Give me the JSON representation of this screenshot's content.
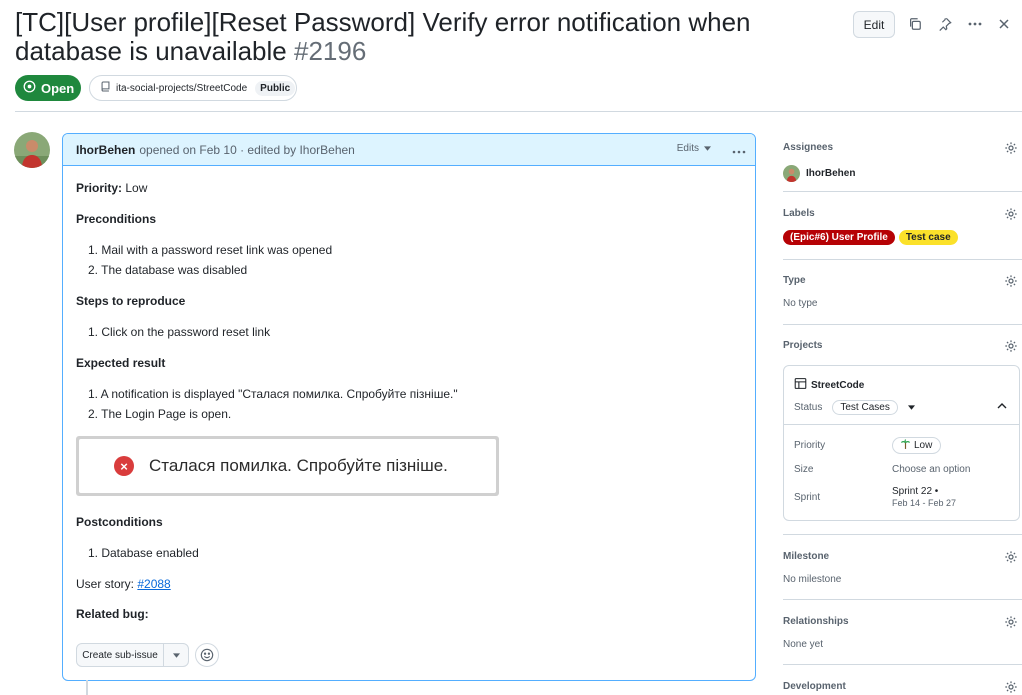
{
  "header": {
    "title": "[TC][User profile][Reset Password] Verify error notification when database is unavailable",
    "number": "#2196",
    "edit_label": "Edit",
    "state": "Open",
    "repo": "ita-social-projects/StreetCode",
    "visibility": "Public"
  },
  "comment": {
    "author": "IhorBehen",
    "meta": "opened on Feb 10 · edited by IhorBehen",
    "edits_label": "Edits",
    "priority_label": "Priority:",
    "priority_value": "Low",
    "preconditions_title": "Preconditions",
    "preconditions": [
      "1. Mail with a password reset link was opened",
      "2. The database was disabled"
    ],
    "steps_title": "Steps to reproduce",
    "steps": [
      "1. Click on the password reset link"
    ],
    "expected_title": "Expected result",
    "expected": [
      "1. A notification is displayed \"Сталася помилка. Спробуйте пізніше.\"",
      "2. The Login Page is open."
    ],
    "screenshot_text": "Сталася помилка. Спробуйте пізніше.",
    "postconditions_title": "Postconditions",
    "postconditions": [
      "1. Database enabled"
    ],
    "user_story_label": "User story:",
    "user_story_link": "#2088",
    "related_bug_label": "Related bug:",
    "create_sub_issue_label": "Create sub-issue"
  },
  "sidebar": {
    "assignees": {
      "title": "Assignees",
      "name": "IhorBehen"
    },
    "labels": {
      "title": "Labels",
      "items": [
        {
          "text": "(Epic#6) User Profile",
          "bg": "#b60205",
          "fg": "#ffffff"
        },
        {
          "text": "Test case",
          "bg": "#fbe12a",
          "fg": "#1f2328"
        }
      ]
    },
    "type": {
      "title": "Type",
      "value": "No type"
    },
    "projects": {
      "title": "Projects",
      "name": "StreetCode",
      "status_label": "Status",
      "status_value": "Test Cases",
      "priority_label": "Priority",
      "priority_value": "Low",
      "size_label": "Size",
      "size_value": "Choose an option",
      "sprint_label": "Sprint",
      "sprint_value": "Sprint 22 •",
      "sprint_dates": "Feb 14 - Feb 27"
    },
    "milestone": {
      "title": "Milestone",
      "value": "No milestone"
    },
    "relationships": {
      "title": "Relationships",
      "value": "None yet"
    },
    "development": {
      "title": "Development"
    }
  },
  "colors": {
    "open_green": "#1f883d",
    "comment_border": "#54aeff",
    "comment_header_bg": "#ddf4ff",
    "link": "#0969da",
    "error_red": "#d93c3c"
  },
  "icons": [
    "copy-icon",
    "pin-icon",
    "more-icon",
    "close-icon",
    "issue-open-icon",
    "repo-icon",
    "gear-icon",
    "table-icon",
    "chevron-up-icon",
    "palm-icon",
    "smiley-icon",
    "error-icon"
  ]
}
